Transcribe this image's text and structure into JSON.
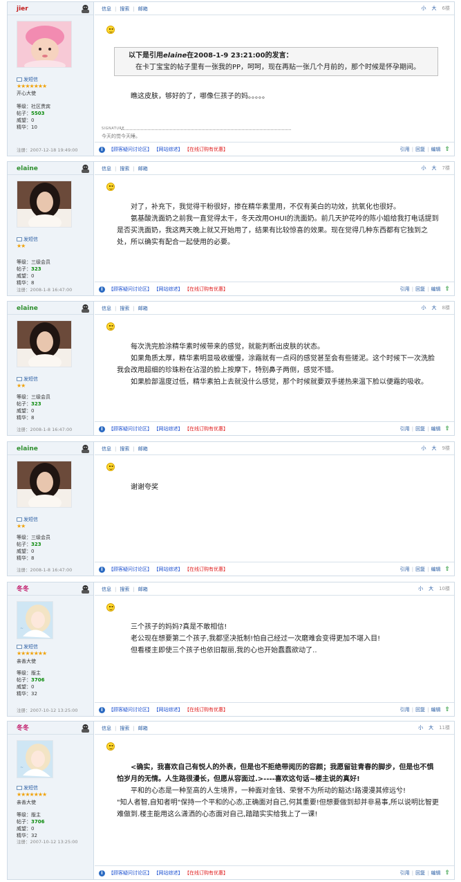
{
  "header_links": {
    "msg": "信息",
    "search": "搜索",
    "mail": "邮箱",
    "small": "小",
    "large": "大"
  },
  "sidebar_labels": {
    "send_msg": "发短信",
    "level_prefix": "等级：",
    "posts_prefix": "帖子：",
    "prestige_prefix": "威望：",
    "elite_prefix": "精华：",
    "reg_prefix": "注册："
  },
  "bottom_links": {
    "faq": "【顾客疑问讨论区】",
    "overview": "【网站综述】",
    "order": "【在线订购有优惠】",
    "quote": "引用",
    "reply": "回复",
    "edit": "编辑",
    "up_icon": "up-arrow"
  },
  "colors": {
    "accent": "#2a5ea5",
    "green": "#0a8a0a",
    "red": "#e02020",
    "sidebar_bg": "#eef3f8",
    "border": "#cfdbe6"
  },
  "posts": [
    {
      "username": "jier",
      "name_color": "#c21a1a",
      "floor": "6楼",
      "stars": "★★★★★★★",
      "title": "开心大使",
      "level": "社区贵宾",
      "posts": "5503",
      "prestige": "0",
      "elite": "10",
      "reg": "2007-12-18 19:49:00",
      "quote_header_pre": "以下是引用",
      "quote_author": "elaine",
      "quote_header_post": "在2008-1-9 23:21:00的发言：",
      "quote_body": "在卡丁宝宝的帖子里有一张我的PP，呵呵，现在再贴一张几个月前的，那个时候是怀孕期间。",
      "paragraphs": [
        "瞧这皮肤，够好的了，哪像仨孩子的妈。。。。。"
      ],
      "sig_label": "SIGNATURE",
      "signature": "今天的觉今天睡。"
    },
    {
      "username": "elaine",
      "name_color": "#2f8f2f",
      "floor": "7楼",
      "stars": "★★",
      "title": "",
      "level": "三级会员",
      "posts": "323",
      "prestige": "0",
      "elite": "8",
      "reg": "2008-1-8 16:47:00",
      "paragraphs": [
        "对了，补充下，我觉得干粉很好，掺在精华素里用，不仅有美白的功效，抗氧化也很好。",
        "氨基酸洗面奶之前我一直觉得太干，冬天改用OHUI的洗面奶。前几天护花呤的陈小姐给我打电话提到是否买洗面奶，我这两天晚上就又开始用了，结果有比较惊喜的效果。现在觉得几种东西都有它独到之处，所以确实有配合一起使用的必要。"
      ]
    },
    {
      "username": "elaine",
      "name_color": "#2f8f2f",
      "floor": "8楼",
      "stars": "★★",
      "title": "",
      "level": "三级会员",
      "posts": "323",
      "prestige": "0",
      "elite": "8",
      "reg": "2008-1-8 16:47:00",
      "paragraphs": [
        "每次洗完脸涂精华素时候带来的感觉，就能判断出皮肤的状态。",
        "如果角质太厚，精华素明显吸收缓慢，涂霜就有一点闷的感觉甚至会有些搓泥。这个时候下一次洗脸我会改用超细的珍珠粉在沾湿的脸上按摩下，特别鼻子两侧，感觉不错。",
        "如果脸部温度过低，精华素拍上去就没什么感觉，那个时候就要双手搓热来温下脸以便霜的吸收。"
      ]
    },
    {
      "username": "elaine",
      "name_color": "#2f8f2f",
      "floor": "9楼",
      "stars": "★★",
      "title": "",
      "level": "三级会员",
      "posts": "323",
      "prestige": "0",
      "elite": "8",
      "reg": "2008-1-8 16:47:00",
      "paragraphs": [
        "谢谢夸奖"
      ]
    },
    {
      "username": "冬冬",
      "name_color": "#c21a6a",
      "floor": "10楼",
      "stars": "★★★★★★★",
      "title": "亲善大使",
      "level": "版主",
      "posts": "3706",
      "prestige": "0",
      "elite": "32",
      "reg": "2007-10-12 13:25:00",
      "paragraphs": [
        "三个孩子的妈妈?真是不敢相信!",
        "老公现在想要第二个孩子,我都坚决抵制!怕自己经过一次磨难会变得更加不堪入目!",
        "但看楼主即使三个孩子也依旧靓丽,我的心也开始蠢蠢欲动了.."
      ]
    },
    {
      "username": "冬冬",
      "name_color": "#c21a6a",
      "floor": "11楼",
      "stars": "★★★★★★★",
      "title": "亲善大使",
      "level": "版主",
      "posts": "3706",
      "prestige": "0",
      "elite": "32",
      "reg": "2007-10-12 13:25:00",
      "bold_paragraph": "<确实，我喜欢自己有悦人的外表，但是也不拒绝带阅历的容颜；我愿留驻青春的脚步，但是也不惧怕岁月的无情。人生路很漫长，但愿从容面过.>----喜欢这句话~楼主说的真好!",
      "paragraphs": [
        "平和的心态是一种至高的人生境界，一种面对金钱、荣誉不为所动的豁达!路漫漫其修远兮!",
        "\"知人者智,自知者明\"保持一个平和的心态,正确面对自己,何其重要!但想要做到却并非易事,所以说明比智更难做到.楼主能用这么潇洒的心态面对自己,踏踏实实给我上了一课!"
      ]
    }
  ]
}
